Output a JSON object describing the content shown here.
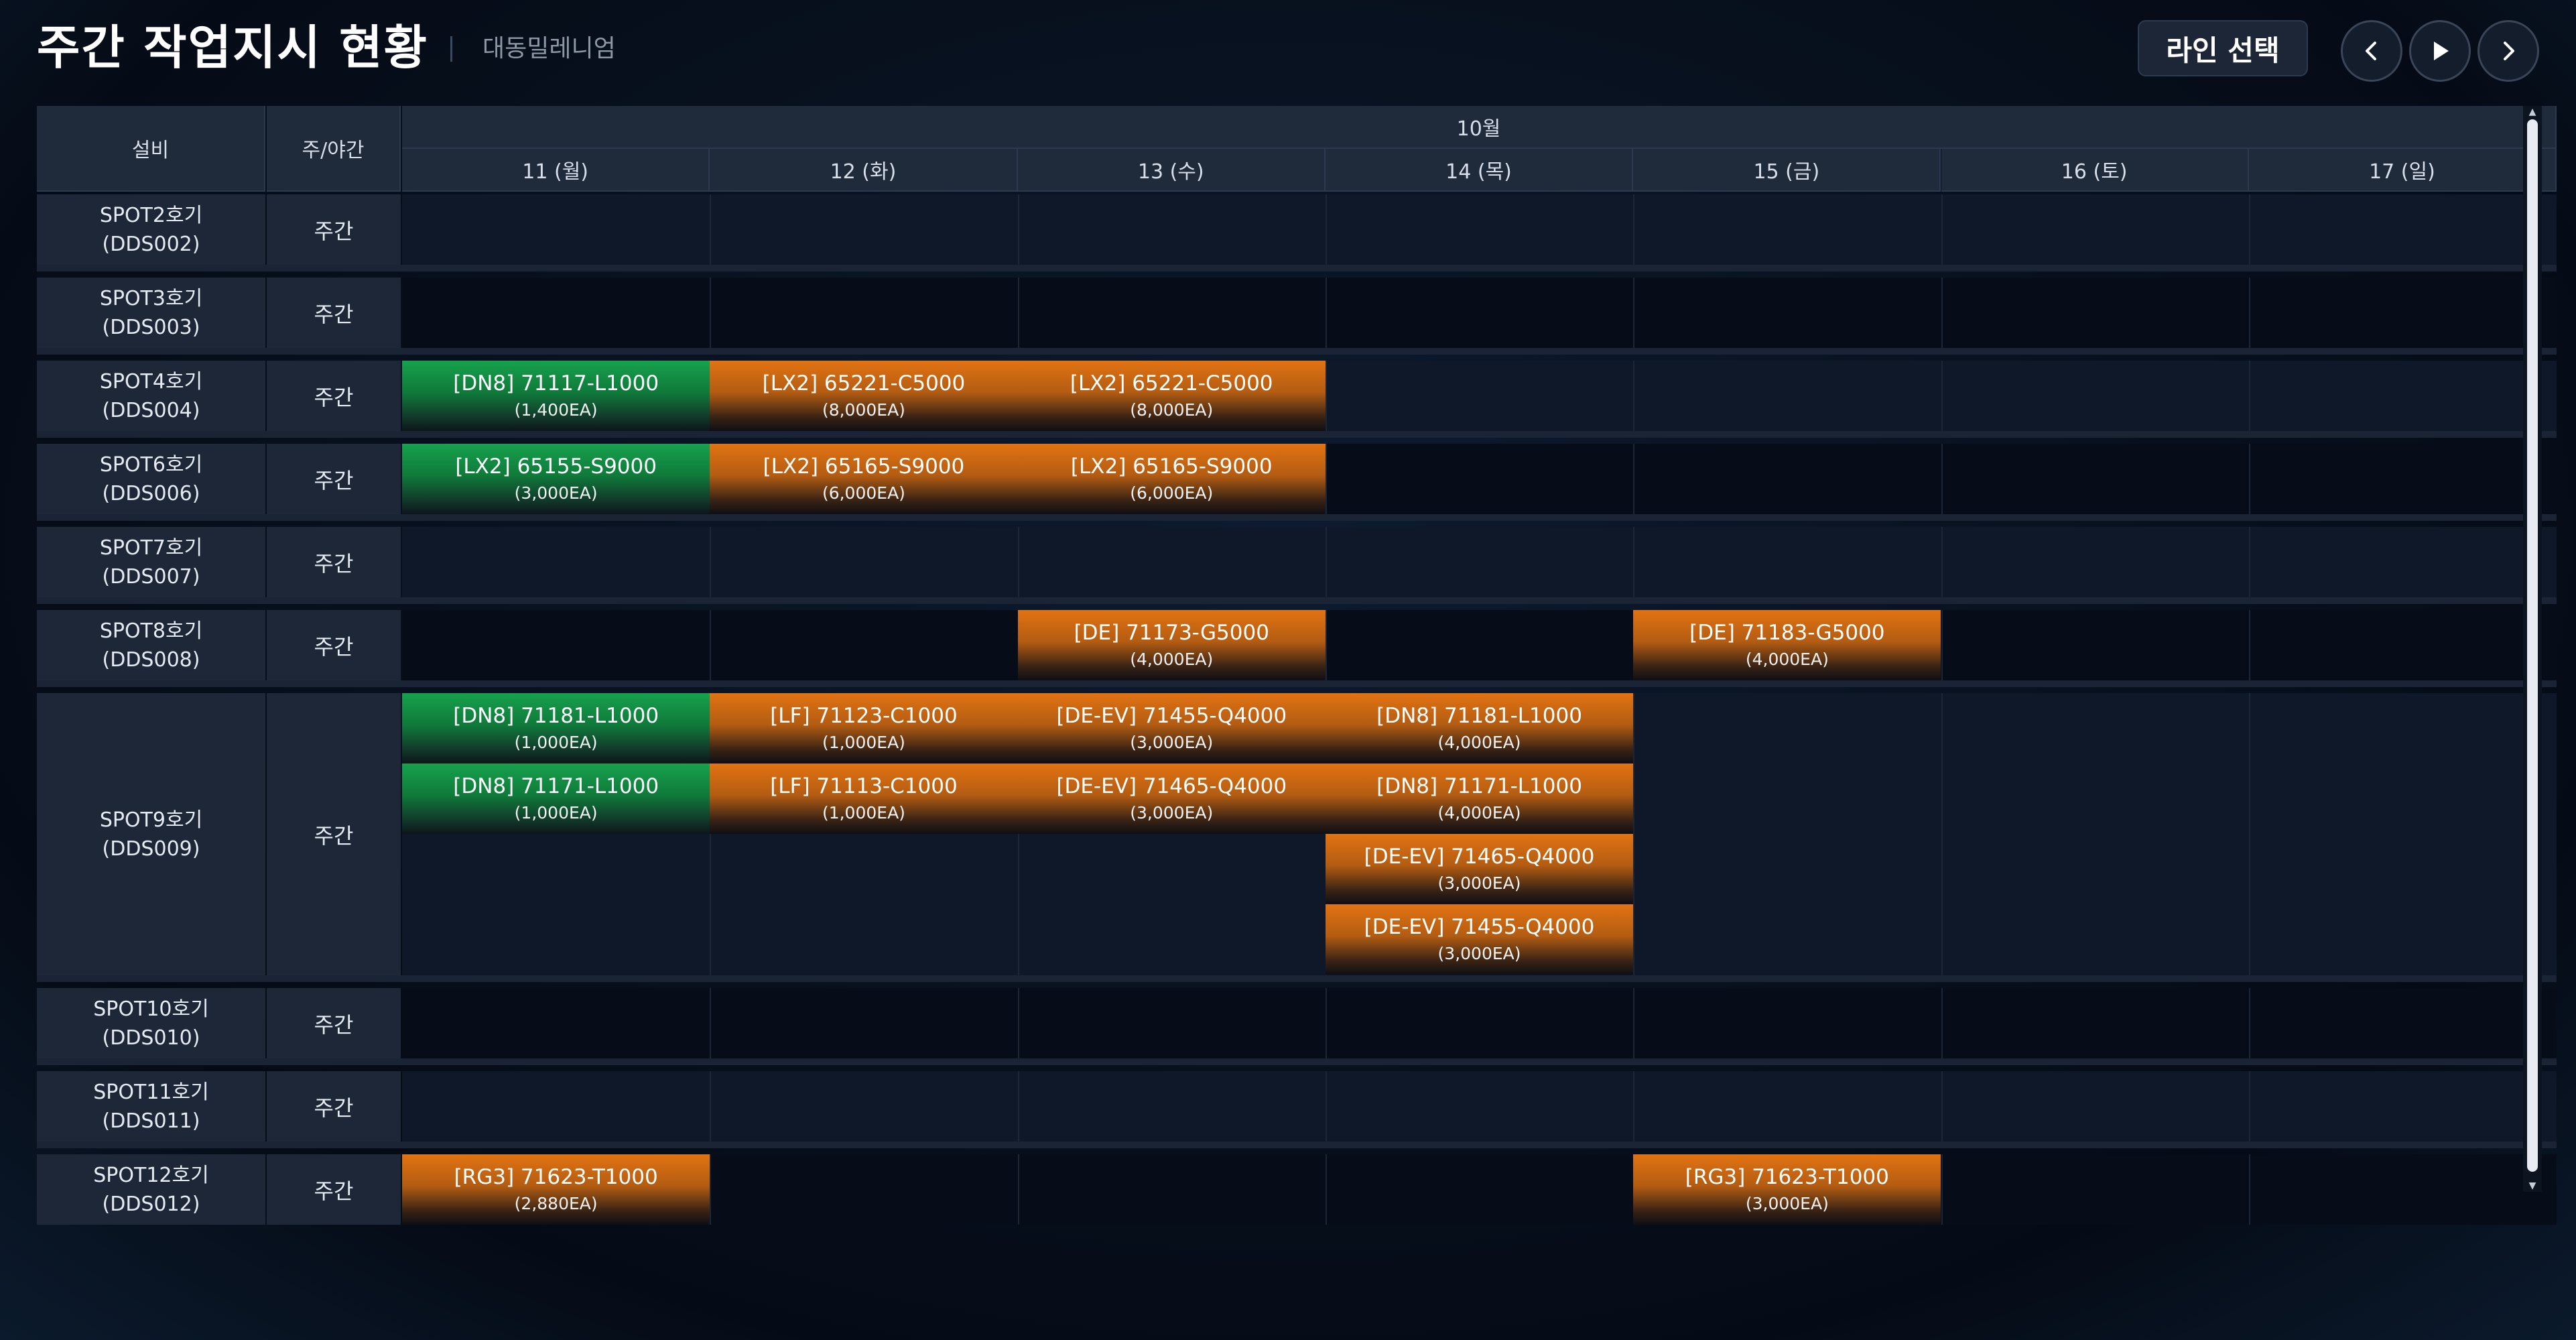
{
  "header": {
    "title": "주간 작업지시 현황",
    "company": "대동밀레니엄",
    "line_select_label": "라인 선택"
  },
  "nav": {
    "prev_icon": "chevron-left-icon",
    "play_icon": "play-icon",
    "next_icon": "chevron-right-icon"
  },
  "table": {
    "equipment_header": "설비",
    "shift_header": "주/야간",
    "month_label": "10월",
    "days": [
      "11 (월)",
      "12 (화)",
      "13 (수)",
      "14 (목)",
      "15 (금)",
      "16 (토)",
      "17 (일)"
    ],
    "rows": [
      {
        "name": "SPOT2호기",
        "code": "(DDS002)",
        "shift": "주간",
        "lanes": 1,
        "jobs": []
      },
      {
        "name": "SPOT3호기",
        "code": "(DDS003)",
        "shift": "주간",
        "lanes": 1,
        "jobs": []
      },
      {
        "name": "SPOT4호기",
        "code": "(DDS004)",
        "shift": "주간",
        "lanes": 1,
        "jobs": [
          {
            "day": 0,
            "lane": 0,
            "color": "green",
            "code": "[DN8] 71117-L1000",
            "qty": "(1,400EA)"
          },
          {
            "day": 1,
            "lane": 0,
            "color": "orange",
            "code": "[LX2] 65221-C5000",
            "qty": "(8,000EA)"
          },
          {
            "day": 2,
            "lane": 0,
            "color": "orange",
            "code": "[LX2] 65221-C5000",
            "qty": "(8,000EA)"
          }
        ]
      },
      {
        "name": "SPOT6호기",
        "code": "(DDS006)",
        "shift": "주간",
        "lanes": 1,
        "jobs": [
          {
            "day": 0,
            "lane": 0,
            "color": "green",
            "code": "[LX2] 65155-S9000",
            "qty": "(3,000EA)"
          },
          {
            "day": 1,
            "lane": 0,
            "color": "orange",
            "code": "[LX2] 65165-S9000",
            "qty": "(6,000EA)"
          },
          {
            "day": 2,
            "lane": 0,
            "color": "orange",
            "code": "[LX2] 65165-S9000",
            "qty": "(6,000EA)"
          }
        ]
      },
      {
        "name": "SPOT7호기",
        "code": "(DDS007)",
        "shift": "주간",
        "lanes": 1,
        "jobs": []
      },
      {
        "name": "SPOT8호기",
        "code": "(DDS008)",
        "shift": "주간",
        "lanes": 1,
        "jobs": [
          {
            "day": 2,
            "lane": 0,
            "color": "orange",
            "code": "[DE] 71173-G5000",
            "qty": "(4,000EA)"
          },
          {
            "day": 4,
            "lane": 0,
            "color": "orange",
            "code": "[DE] 71183-G5000",
            "qty": "(4,000EA)"
          }
        ]
      },
      {
        "name": "SPOT9호기",
        "code": "(DDS009)",
        "shift": "주간",
        "lanes": 4,
        "jobs": [
          {
            "day": 0,
            "lane": 0,
            "color": "green",
            "code": "[DN8] 71181-L1000",
            "qty": "(1,000EA)"
          },
          {
            "day": 0,
            "lane": 1,
            "color": "green",
            "code": "[DN8] 71171-L1000",
            "qty": "(1,000EA)"
          },
          {
            "day": 1,
            "lane": 0,
            "color": "orange",
            "code": "[LF] 71123-C1000",
            "qty": "(1,000EA)"
          },
          {
            "day": 1,
            "lane": 1,
            "color": "orange",
            "code": "[LF] 71113-C1000",
            "qty": "(1,000EA)"
          },
          {
            "day": 2,
            "lane": 0,
            "color": "orange",
            "code": "[DE-EV] 71455-Q4000",
            "qty": "(3,000EA)"
          },
          {
            "day": 2,
            "lane": 1,
            "color": "orange",
            "code": "[DE-EV] 71465-Q4000",
            "qty": "(3,000EA)"
          },
          {
            "day": 3,
            "lane": 0,
            "color": "orange",
            "code": "[DN8] 71181-L1000",
            "qty": "(4,000EA)"
          },
          {
            "day": 3,
            "lane": 1,
            "color": "orange",
            "code": "[DN8] 71171-L1000",
            "qty": "(4,000EA)"
          },
          {
            "day": 3,
            "lane": 2,
            "color": "orange",
            "code": "[DE-EV] 71465-Q4000",
            "qty": "(3,000EA)"
          },
          {
            "day": 3,
            "lane": 3,
            "color": "orange",
            "code": "[DE-EV] 71455-Q4000",
            "qty": "(3,000EA)"
          }
        ]
      },
      {
        "name": "SPOT10호기",
        "code": "(DDS010)",
        "shift": "주간",
        "lanes": 1,
        "jobs": []
      },
      {
        "name": "SPOT11호기",
        "code": "(DDS011)",
        "shift": "주간",
        "lanes": 1,
        "jobs": []
      },
      {
        "name": "SPOT12호기",
        "code": "(DDS012)",
        "shift": "주간",
        "lanes": 1,
        "jobs": [
          {
            "day": 0,
            "lane": 0,
            "color": "orange",
            "code": "[RG3] 71623-T1000",
            "qty": "(2,880EA)"
          },
          {
            "day": 4,
            "lane": 0,
            "color": "orange",
            "code": "[RG3] 71623-T1000",
            "qty": "(3,000EA)"
          }
        ]
      }
    ]
  }
}
